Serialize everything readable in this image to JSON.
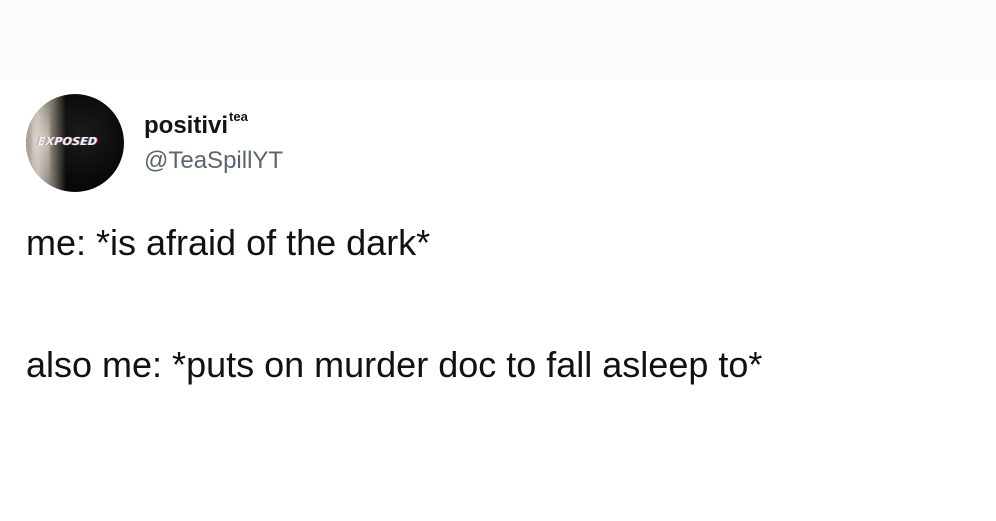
{
  "tweet": {
    "author": {
      "display_name": "positivi",
      "display_name_superscript": "tea",
      "handle": "@TeaSpillYT",
      "avatar_text": "EXPOSED"
    },
    "lines": [
      "me: *is afraid of the dark*",
      "also me: *puts on murder doc to fall asleep to*"
    ]
  },
  "colors": {
    "page_background": "#fbfbfb",
    "card_background": "#ffffff",
    "text_primary": "#111111",
    "handle_gray": "#5b6570"
  }
}
